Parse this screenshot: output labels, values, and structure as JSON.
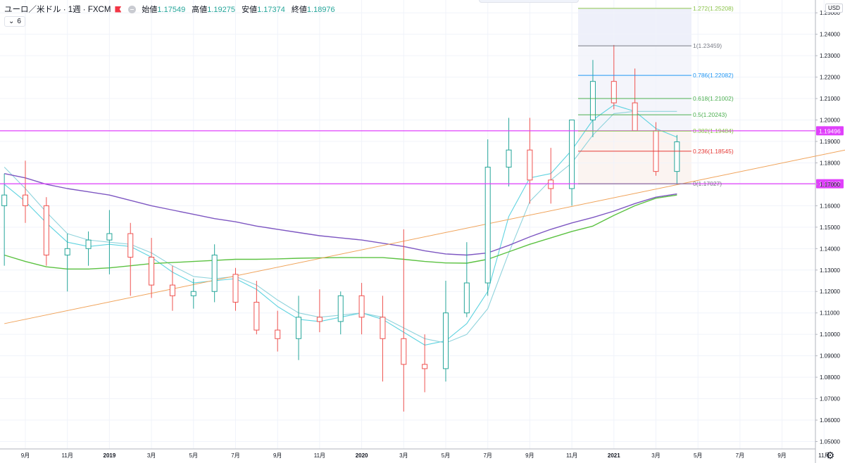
{
  "header": {
    "symbol": "ユーロ／米ドル · 1週 · FXCM",
    "ohlc": [
      {
        "label": "始値",
        "value": "1.17549"
      },
      {
        "label": "高値",
        "value": "1.19275"
      },
      {
        "label": "安値",
        "value": "1.17374"
      },
      {
        "label": "終値",
        "value": "1.18976"
      }
    ],
    "collapse_value": "6",
    "currency": "USD"
  },
  "colors": {
    "up": "#26a69a",
    "down": "#ef5350",
    "ma_fast": "#5fd3e0",
    "ma_mid": "#8fd3dc",
    "ma_long_purple": "#7e57c2",
    "ma_long_green": "#5cc242",
    "trendline": "#f0a35a",
    "hline": "#e040fb",
    "fib_box": "#f3f4fb"
  },
  "chart_data": {
    "type": "candlestick",
    "x": [
      "2018-08",
      "2018-09",
      "2018-10",
      "2018-11",
      "2018-12",
      "2019-01",
      "2019-02",
      "2019-03",
      "2019-04",
      "2019-05",
      "2019-06",
      "2019-07",
      "2019-08",
      "2019-09",
      "2019-10",
      "2019-11",
      "2019-12",
      "2020-01",
      "2020-02",
      "2020-03",
      "2020-04",
      "2020-05",
      "2020-06",
      "2020-07",
      "2020-08",
      "2020-09",
      "2020-10",
      "2020-11",
      "2020-12",
      "2021-01",
      "2021-02",
      "2021-03",
      "2021-04"
    ],
    "x_tick_labels": [
      {
        "label": "9月",
        "date": "2018-09"
      },
      {
        "label": "11月",
        "date": "2018-11"
      },
      {
        "label": "2019",
        "date": "2019-01"
      },
      {
        "label": "3月",
        "date": "2019-03"
      },
      {
        "label": "5月",
        "date": "2019-05"
      },
      {
        "label": "7月",
        "date": "2019-07"
      },
      {
        "label": "9月",
        "date": "2019-09"
      },
      {
        "label": "11月",
        "date": "2019-11"
      },
      {
        "label": "2020",
        "date": "2020-01"
      },
      {
        "label": "3月",
        "date": "2020-03"
      },
      {
        "label": "5月",
        "date": "2020-05"
      },
      {
        "label": "7月",
        "date": "2020-07"
      },
      {
        "label": "9月",
        "date": "2020-09"
      },
      {
        "label": "11月",
        "date": "2020-11"
      },
      {
        "label": "2021",
        "date": "2021-01"
      },
      {
        "label": "3月",
        "date": "2021-03"
      },
      {
        "label": "5月",
        "date": "2021-05"
      },
      {
        "label": "7月",
        "date": "2021-07"
      },
      {
        "label": "9月",
        "date": "2021-09"
      },
      {
        "label": "11月",
        "date": "2021-11"
      }
    ],
    "y_ticks": [
      "1.05000",
      "1.06000",
      "1.07000",
      "1.08000",
      "1.09000",
      "1.10000",
      "1.11000",
      "1.12000",
      "1.13000",
      "1.14000",
      "1.15000",
      "1.16000",
      "1.17000",
      "1.18000",
      "1.19000",
      "1.20000",
      "1.21000",
      "1.22000",
      "1.23000",
      "1.24000",
      "1.25000"
    ],
    "ylim": [
      1.046,
      1.256
    ],
    "series": [
      {
        "name": "candles",
        "open": [
          1.16,
          1.165,
          1.16,
          1.137,
          1.14,
          1.144,
          1.147,
          1.136,
          1.123,
          1.118,
          1.12,
          1.128,
          1.115,
          1.102,
          1.098,
          1.108,
          1.106,
          1.118,
          1.108,
          1.098,
          1.086,
          1.084,
          1.11,
          1.124,
          1.178,
          1.186,
          1.172,
          1.168,
          1.2,
          1.218,
          1.208,
          1.195,
          1.176
        ],
        "high": [
          1.175,
          1.181,
          1.164,
          1.147,
          1.148,
          1.158,
          1.152,
          1.145,
          1.132,
          1.126,
          1.142,
          1.131,
          1.125,
          1.111,
          1.118,
          1.121,
          1.12,
          1.124,
          1.118,
          1.149,
          1.1,
          1.125,
          1.143,
          1.191,
          1.201,
          1.201,
          1.187,
          1.2,
          1.228,
          1.235,
          1.224,
          1.199,
          1.193
        ],
        "low": [
          1.132,
          1.152,
          1.132,
          1.12,
          1.132,
          1.128,
          1.118,
          1.117,
          1.111,
          1.112,
          1.115,
          1.111,
          1.1,
          1.092,
          1.088,
          1.101,
          1.1,
          1.1,
          1.078,
          1.064,
          1.073,
          1.078,
          1.108,
          1.118,
          1.169,
          1.161,
          1.161,
          1.16,
          1.192,
          1.205,
          1.195,
          1.174,
          1.17
        ],
        "close": [
          1.165,
          1.16,
          1.137,
          1.14,
          1.144,
          1.147,
          1.136,
          1.123,
          1.118,
          1.12,
          1.137,
          1.115,
          1.102,
          1.098,
          1.108,
          1.106,
          1.118,
          1.108,
          1.098,
          1.086,
          1.084,
          1.11,
          1.124,
          1.178,
          1.186,
          1.172,
          1.168,
          1.2,
          1.218,
          1.208,
          1.195,
          1.176,
          1.1898
        ]
      },
      {
        "name": "ma_fast",
        "values": [
          1.17,
          1.162,
          1.152,
          1.143,
          1.141,
          1.142,
          1.141,
          1.136,
          1.129,
          1.124,
          1.125,
          1.126,
          1.121,
          1.113,
          1.107,
          1.106,
          1.108,
          1.11,
          1.107,
          1.101,
          1.095,
          1.097,
          1.105,
          1.12,
          1.155,
          1.173,
          1.175,
          1.186,
          1.2,
          1.207,
          1.204,
          1.196,
          1.192
        ]
      },
      {
        "name": "ma_mid",
        "values": [
          1.178,
          1.168,
          1.157,
          1.147,
          1.144,
          1.143,
          1.142,
          1.138,
          1.132,
          1.127,
          1.126,
          1.127,
          1.123,
          1.116,
          1.11,
          1.108,
          1.109,
          1.11,
          1.108,
          1.103,
          1.098,
          1.096,
          1.1,
          1.112,
          1.138,
          1.162,
          1.172,
          1.18,
          1.193,
          1.203,
          1.204,
          1.204,
          1.204
        ]
      },
      {
        "name": "ma_long_purple",
        "values": [
          1.175,
          1.173,
          1.17,
          1.168,
          1.1665,
          1.165,
          1.1625,
          1.16,
          1.158,
          1.156,
          1.154,
          1.1525,
          1.1505,
          1.149,
          1.1475,
          1.146,
          1.145,
          1.144,
          1.1425,
          1.141,
          1.139,
          1.1375,
          1.137,
          1.138,
          1.1415,
          1.1455,
          1.149,
          1.152,
          1.1545,
          1.1575,
          1.161,
          1.164,
          1.1655
        ]
      },
      {
        "name": "ma_long_green",
        "values": [
          1.137,
          1.134,
          1.1315,
          1.1305,
          1.1305,
          1.131,
          1.132,
          1.133,
          1.1335,
          1.134,
          1.1345,
          1.135,
          1.135,
          1.1352,
          1.1355,
          1.1357,
          1.1358,
          1.1358,
          1.1358,
          1.135,
          1.134,
          1.1333,
          1.1332,
          1.135,
          1.1385,
          1.142,
          1.145,
          1.148,
          1.1505,
          1.1555,
          1.16,
          1.1635,
          1.165
        ]
      }
    ],
    "trendline": {
      "from": [
        "2018-08",
        1.105
      ],
      "to": [
        "2021-12",
        1.186
      ]
    },
    "horizontal_lines": [
      {
        "value": 1.19496,
        "label": "1.19496"
      },
      {
        "value": 1.17027,
        "label": "1.17027"
      }
    ],
    "fibonacci": [
      {
        "ratio": "1.272",
        "value": 1.25208,
        "label": "1.272(1.25208)",
        "color": "#8bc34a"
      },
      {
        "ratio": "1",
        "value": 1.23459,
        "label": "1(1.23459)",
        "color": "#787b86"
      },
      {
        "ratio": "0.786",
        "value": 1.22082,
        "label": "0.786(1.22082)",
        "color": "#2196f3"
      },
      {
        "ratio": "0.618",
        "value": 1.21002,
        "label": "0.618(1.21002)",
        "color": "#4caf50"
      },
      {
        "ratio": "0.5",
        "value": 1.20243,
        "label": "0.5(1.20243)",
        "color": "#4caf50"
      },
      {
        "ratio": "0.382",
        "value": 1.19484,
        "label": "0.382(1.19484)",
        "color": "#8bc34a"
      },
      {
        "ratio": "0.236",
        "value": 1.18545,
        "label": "0.236(1.18545)",
        "color": "#e53935"
      },
      {
        "ratio": "0",
        "value": 1.17027,
        "label": "0(1.17027)",
        "color": "#787b86"
      }
    ]
  }
}
